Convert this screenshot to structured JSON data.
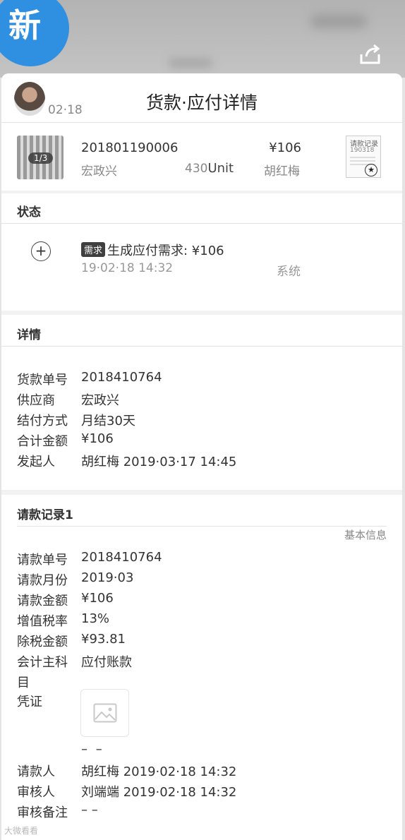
{
  "badge": {
    "text": "新"
  },
  "header": {
    "title": "货款·应付详情",
    "date": "02·18"
  },
  "order": {
    "thumb_counter": "1/3",
    "number": "201801190006",
    "amount": "¥106",
    "supplier": "宏政兴",
    "qty_value": "430",
    "qty_unit": "Unit",
    "person": "胡红梅",
    "receipt_title": "请款记录",
    "receipt_sub": "190318"
  },
  "status": {
    "title": "状态",
    "tag": "需求",
    "event": "生成应付需求: ¥106",
    "time": "19·02·18 14:32",
    "actor": "系统"
  },
  "details": {
    "title": "详情",
    "rows": [
      {
        "label": "货款单号",
        "value": "2018410764"
      },
      {
        "label": "供应商",
        "value": "宏政兴"
      },
      {
        "label": "结付方式",
        "value": "月结30天"
      },
      {
        "label": "合计金额",
        "value": "¥106"
      },
      {
        "label": "发起人",
        "value": "胡红梅 2019·03·17 14:45"
      }
    ]
  },
  "request": {
    "title": "请款记录1",
    "basic_info": "基本信息",
    "rows": [
      {
        "label": "请款单号",
        "value": "2018410764"
      },
      {
        "label": "请款月份",
        "value": "2019·03"
      },
      {
        "label": "请款金额",
        "value": "¥106"
      },
      {
        "label": "增值税率",
        "value": "13%"
      },
      {
        "label": "除税金额",
        "value": "¥93.81"
      },
      {
        "label": "会计主科目",
        "value": "应付账款"
      }
    ],
    "voucher_label": "凭证",
    "voucher_empty": "– –",
    "rows2": [
      {
        "label": "请款人",
        "value": "胡红梅 2019·02·18 14:32"
      },
      {
        "label": "审核人",
        "value": "刘端端 2019·02·18 14:32"
      },
      {
        "label": "审核备注",
        "value": "– –"
      }
    ]
  },
  "watermark": "大微看看"
}
